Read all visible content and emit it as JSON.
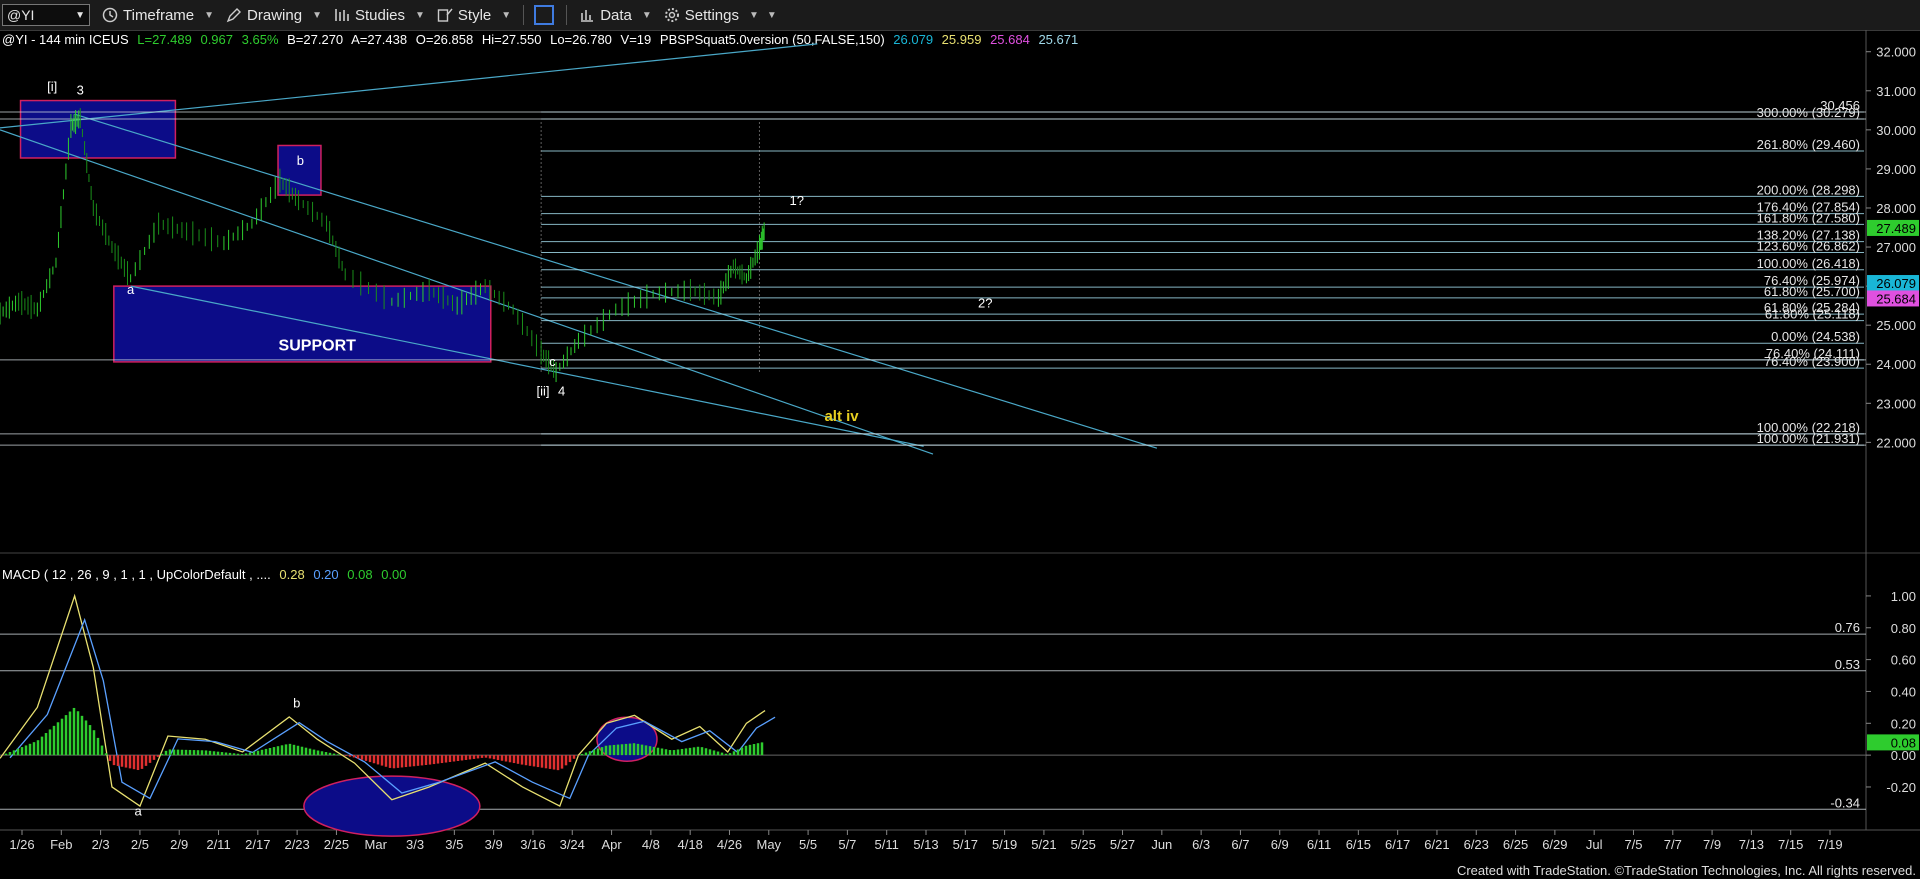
{
  "toolbar": {
    "symbol": "@YI",
    "items": [
      {
        "label": "Timeframe",
        "icon": "clock-icon"
      },
      {
        "label": "Drawing",
        "icon": "pencil-icon"
      },
      {
        "label": "Studies",
        "icon": "studies-icon"
      },
      {
        "label": "Style",
        "icon": "style-icon"
      },
      {
        "label": "Data",
        "icon": "data-icon"
      },
      {
        "label": "Settings",
        "icon": "gear-icon"
      }
    ]
  },
  "header": {
    "title": "@YI - 144 min ICEUS",
    "L": "L=27.489",
    "chg": "0.967",
    "pct": "3.65%",
    "B": "B=27.270",
    "A": "A=27.438",
    "O": "O=26.858",
    "Hi": "Hi=27.550",
    "Lo": "Lo=26.780",
    "V": "V=19",
    "study": "PBSPSquat5.0version (50,FALSE,150)",
    "v1": "26.079",
    "v2": "25.959",
    "v3": "25.684",
    "v4": "25.671"
  },
  "macd_header": {
    "title": "MACD ( 12 , 26 , 9 , 1 , 1 , UpColorDefault , ....",
    "v1": "0.28",
    "v2": "0.20",
    "v3": "0.08",
    "v4": "0.00"
  },
  "colors": {
    "up": "#2ecc2e",
    "down": "#e03030",
    "fib": "#9fd8e8",
    "box": "#0c0c88",
    "boxBorder": "#d02060",
    "trend": "#4aa8c8",
    "macd": "#5aa0ff",
    "signal": "#e8e070"
  },
  "chart_data": [
    {
      "type": "candlestick",
      "title": "@YI - 144 min ICEUS",
      "ylim": [
        21.6,
        32.3
      ],
      "yticks": [
        "32.000",
        "31.000",
        "30.000",
        "29.000",
        "28.000",
        "27.000",
        "26.000",
        "25.000",
        "24.000",
        "23.000",
        "22.000"
      ],
      "xticks": [
        "1/26",
        "Feb",
        "2/3",
        "2/5",
        "2/9",
        "2/11",
        "2/17",
        "2/23",
        "2/25",
        "Mar",
        "3/3",
        "3/5",
        "3/9",
        "3/16",
        "3/24",
        "Apr",
        "4/8",
        "4/18",
        "4/26",
        "May",
        "5/5",
        "5/7",
        "5/11",
        "5/13",
        "5/17",
        "5/19",
        "5/21",
        "5/25",
        "5/27",
        "Jun",
        "6/3",
        "6/7",
        "6/9",
        "6/11",
        "6/15",
        "6/17",
        "6/21",
        "6/23",
        "6/25",
        "6/29",
        "Jul",
        "7/5",
        "7/7",
        "7/9",
        "7/13",
        "7/15",
        "7/19"
      ],
      "last_price": "27.489",
      "price_tags": [
        {
          "value": "27.489",
          "color": "#2ecc2e"
        },
        {
          "value": "26.079",
          "color": "#19b6d6"
        },
        {
          "value": "25.684",
          "color": "#e050e0"
        }
      ],
      "fib_labels": [
        {
          "text": "30.456",
          "price": 30.456
        },
        {
          "text": "300.00% (30.279)",
          "price": 30.279
        },
        {
          "text": "261.80% (29.460)",
          "price": 29.46
        },
        {
          "text": "200.00% (28.298)",
          "price": 28.298
        },
        {
          "text": "176.40% (27.854)",
          "price": 27.854
        },
        {
          "text": "161.80% (27.580)",
          "price": 27.58
        },
        {
          "text": "138.20% (27.138)",
          "price": 27.138
        },
        {
          "text": "123.60% (26.862)",
          "price": 26.862
        },
        {
          "text": "100.00% (26.418)",
          "price": 26.418
        },
        {
          "text": "76.40% (25.974)",
          "price": 25.974
        },
        {
          "text": "61.80% (25.700)",
          "price": 25.7
        },
        {
          "text": "61.80% (25.284)",
          "price": 25.284
        },
        {
          "text": "61.80% (25.118)",
          "price": 25.118
        },
        {
          "text": "0.00% (24.538)",
          "price": 24.538
        },
        {
          "text": "76.40% (24.111)",
          "price": 24.111
        },
        {
          "text": "76.40% (23.900)",
          "price": 23.9
        },
        {
          "text": "100.00% (22.218)",
          "price": 22.218
        },
        {
          "text": "100.00% (21.931)",
          "price": 21.931
        }
      ],
      "annotations": [
        {
          "text": "[i]",
          "x": 0.028,
          "price": 31.0
        },
        {
          "text": "3",
          "x": 0.043,
          "price": 30.9
        },
        {
          "text": "b",
          "x": 0.161,
          "price": 29.1
        },
        {
          "text": "a",
          "x": 0.07,
          "price": 25.8
        },
        {
          "text": "SUPPORT",
          "x": 0.17,
          "price": 24.35
        },
        {
          "text": "c",
          "x": 0.296,
          "price": 23.95
        },
        {
          "text": "[ii]",
          "x": 0.291,
          "price": 23.2
        },
        {
          "text": "4",
          "x": 0.301,
          "price": 23.2
        },
        {
          "text": "1?",
          "x": 0.427,
          "price": 28.08
        },
        {
          "text": "2?",
          "x": 0.528,
          "price": 25.45
        },
        {
          "text": "alt iv",
          "x": 0.451,
          "price": 22.55
        }
      ],
      "boxes": [
        {
          "x0": 0.011,
          "x1": 0.094,
          "p0": 30.75,
          "p1": 29.28
        },
        {
          "x0": 0.149,
          "x1": 0.172,
          "p0": 29.6,
          "p1": 28.33
        },
        {
          "x0": 0.061,
          "x1": 0.263,
          "p0": 26.0,
          "p1": 24.06
        }
      ]
    },
    {
      "type": "macd",
      "title": "MACD ( 12 , 26 , 9 , 1 , 1 , UpColorDefault , ....",
      "ylim": [
        -0.42,
        1.1
      ],
      "yticks": [
        "1.00",
        "0.80",
        "0.60",
        "0.40",
        "0.20",
        "0.00",
        "-0.20"
      ],
      "levels": [
        {
          "value": 0.76,
          "label": "0.76"
        },
        {
          "value": 0.53,
          "label": "0.53"
        },
        {
          "value": -0.34,
          "label": "-0.34"
        }
      ],
      "current_tag": "0.08",
      "annotations": [
        {
          "text": "b",
          "x": 0.159,
          "value": 0.3
        },
        {
          "text": "a",
          "x": 0.074,
          "value": -0.38
        }
      ]
    }
  ],
  "footer": {
    "credit": "Created with TradeStation. ©TradeStation Technologies, Inc. All rights reserved."
  }
}
